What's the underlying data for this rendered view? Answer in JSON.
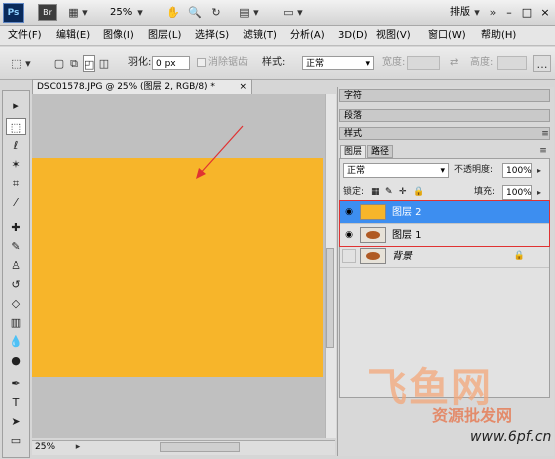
{
  "app": {
    "logo": "Ps",
    "bridge": "Br",
    "zoom": "25%",
    "workspace": "排版",
    "window_controls": [
      "–",
      "□",
      "×"
    ]
  },
  "menu": [
    "文件(F)",
    "编辑(E)",
    "图像(I)",
    "图层(L)",
    "选择(S)",
    "滤镜(T)",
    "分析(A)",
    "3D(D)",
    "视图(V)",
    "窗口(W)",
    "帮助(H)"
  ],
  "options": {
    "feather_label": "羽化:",
    "feather_value": "0 px",
    "antialias_label": "消除锯齿",
    "style_label": "样式:",
    "style_value": "正常",
    "width_label": "宽度:",
    "height_label": "高度:"
  },
  "document": {
    "tab_title": "DSC01578.JPG @ 25% (图层 2, RGB/8) *",
    "status_zoom": "25%"
  },
  "panels": {
    "collapsed": [
      "字符",
      "段落",
      "样式"
    ],
    "tabs": [
      "图层",
      "路径"
    ],
    "blend_mode": "正常",
    "opacity_label": "不透明度:",
    "opacity_value": "100%",
    "lock_label": "锁定:",
    "fill_label": "填充:",
    "fill_value": "100%",
    "layers": [
      {
        "name": "图层 2"
      },
      {
        "name": "图层 1"
      },
      {
        "name": "背景"
      }
    ]
  },
  "watermark": {
    "logo": "飞鱼网",
    "text": "资源批发网",
    "url": "www.6pf.cn"
  },
  "colors": {
    "image_fill": "#f7b52a",
    "selection": "#3d8ef0",
    "annotation": "#e03232"
  }
}
